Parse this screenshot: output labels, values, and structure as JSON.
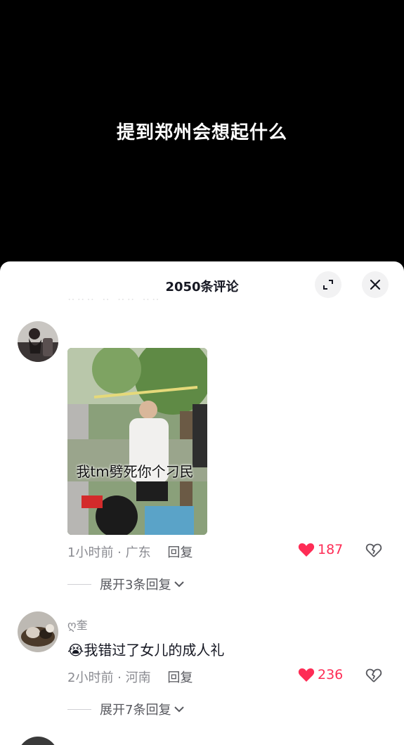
{
  "video": {
    "caption": "提到郑州会想起什么"
  },
  "comments_panel": {
    "title": "2050条评论",
    "expand_icon": "expand-icon",
    "close_icon": "close-icon"
  },
  "comments": [
    {
      "username": "",
      "image_caption": "我tm劈死你个刁民",
      "time_location": "1小时前 · 广东",
      "reply_label": "回复",
      "likes": "187",
      "expand_replies": "展开3条回复"
    },
    {
      "username": "ღ奎",
      "text": "我错过了女儿的成人礼",
      "emoji": "😭",
      "time_location": "2小时前 · 河南",
      "reply_label": "回复",
      "likes": "236",
      "expand_replies": "展开7条回复"
    }
  ],
  "colors": {
    "accent": "#fe2c55",
    "text_primary": "#161823",
    "text_secondary": "#8a8b91"
  }
}
